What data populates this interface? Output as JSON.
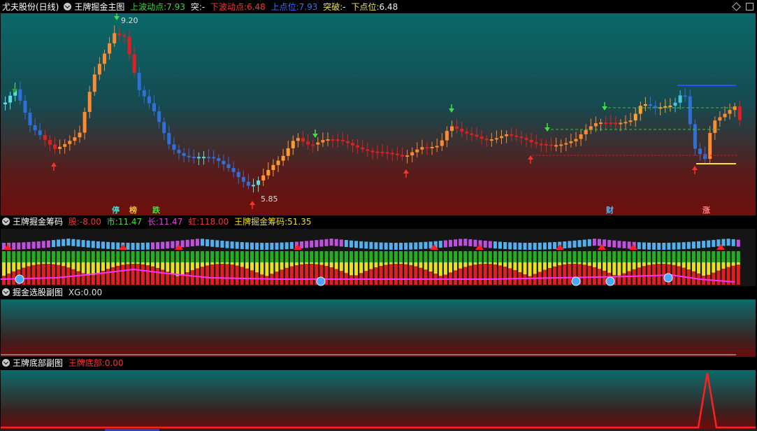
{
  "main": {
    "stock": "尤夫股份(日线)",
    "indicator": "王牌掘金主图",
    "items": [
      {
        "label": "上波动点:",
        "value": "7.93",
        "color": "#3fd63f"
      },
      {
        "label": "突:",
        "value": "-",
        "color": "#e8e8e8"
      },
      {
        "label": "下波动点:",
        "value": "6.48",
        "color": "#ff3030"
      },
      {
        "label": "上点位:",
        "value": "7.93",
        "color": "#3a6cff"
      },
      {
        "label": "突破:",
        "value": "-",
        "color": "#f0e060"
      },
      {
        "label": "下点位:",
        "value": "6.48",
        "color": "#f0f0f0"
      }
    ],
    "high_label": "9.20",
    "low_label": "5.85",
    "tags": [
      {
        "text": "停",
        "color": "#40e0d0"
      },
      {
        "text": "榜",
        "color": "#f0c040"
      },
      {
        "text": "跌",
        "color": "#40e040"
      },
      {
        "text": "财",
        "color": "#40c0ff"
      },
      {
        "text": "涨",
        "color": "#ff8080"
      }
    ]
  },
  "sub1": {
    "title": "王牌掘金筹码",
    "items": [
      {
        "label": "股:",
        "value": "-8.00",
        "color": "#ff3030"
      },
      {
        "label": "市:",
        "value": "11.47",
        "color": "#40e040"
      },
      {
        "label": "长:",
        "value": "11.47",
        "color": "#e040e0"
      },
      {
        "label": "虹:",
        "value": "118.00",
        "color": "#ff3030"
      },
      {
        "label": "王牌掘金筹码:",
        "value": "51.35",
        "color": "#f0e020"
      }
    ]
  },
  "sub2": {
    "title": "掘金选股副图",
    "items": [
      {
        "label": "XG:",
        "value": "0.00",
        "color": "#dddddd"
      }
    ]
  },
  "sub3": {
    "title": "王牌底部副图",
    "items": [
      {
        "label": "王牌底部:",
        "value": "0.00",
        "color": "#ff3030"
      }
    ]
  }
}
